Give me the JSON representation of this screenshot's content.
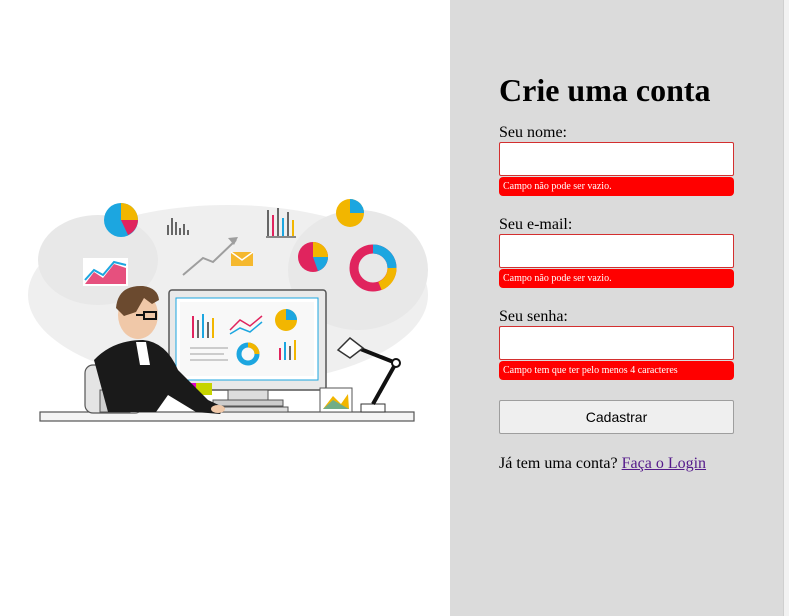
{
  "form": {
    "title": "Crie uma conta",
    "name_label": "Seu nome:",
    "name_value": "",
    "name_error": "Campo não pode ser vazio.",
    "email_label": "Seu e-mail:",
    "email_value": "",
    "email_error": "Campo não pode ser vazio.",
    "password_label": "Seu senha:",
    "password_value": "",
    "password_error": "Campo tem que ter pelo menos 4 caracteres",
    "submit_label": "Cadastrar",
    "login_prompt": "Já tem uma conta?",
    "login_link": "Faça o Login"
  },
  "illustration": {
    "name": "data-analyst-illustration"
  },
  "colors": {
    "panel_background": "#dbdbdb",
    "error_background": "#ff0000",
    "input_border": "#d32f2f",
    "link_color": "#551a8b"
  }
}
